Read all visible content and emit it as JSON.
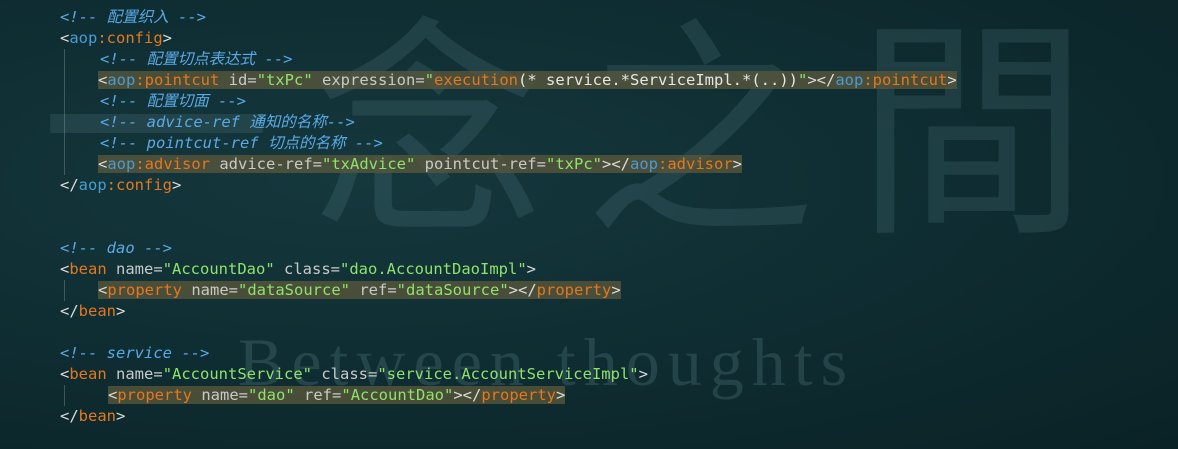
{
  "watermark": {
    "cjk": "一念之間",
    "en": "Between thoughts"
  },
  "lines": [
    {
      "indent": 60,
      "hl": false,
      "tokens": [
        [
          "c-comment",
          "<!-- 配置织入 -->"
        ]
      ]
    },
    {
      "indent": 60,
      "hl": false,
      "tokens": [
        [
          "c-bracket",
          "<"
        ],
        [
          "c-ns",
          "aop"
        ],
        [
          "c-tag",
          ":config"
        ],
        [
          "c-bracket",
          ">"
        ]
      ]
    },
    {
      "indent": 100,
      "hl": false,
      "tokens": [
        [
          "c-comment",
          "<!-- 配置切点表达式 -->"
        ]
      ]
    },
    {
      "indent": 98,
      "hl": true,
      "tokens": [
        [
          "c-bracket",
          "<"
        ],
        [
          "c-ns",
          "aop"
        ],
        [
          "c-tag",
          ":pointcut"
        ],
        [
          "c-attr",
          " id"
        ],
        [
          "c-eq",
          "="
        ],
        [
          "c-str",
          "\"txPc\""
        ],
        [
          "c-attr",
          " expression"
        ],
        [
          "c-eq",
          "="
        ],
        [
          "c-str",
          "\""
        ],
        [
          "c-call",
          "execution"
        ],
        [
          "c-plain",
          "(* service.*ServiceImpl.*(..))"
        ],
        [
          "c-str",
          "\""
        ],
        [
          "c-bracket",
          "></"
        ],
        [
          "c-ns",
          "aop"
        ],
        [
          "c-tag",
          ":pointcut"
        ],
        [
          "c-bracket",
          ">"
        ]
      ]
    },
    {
      "indent": 100,
      "hl": false,
      "tokens": [
        [
          "c-comment",
          "<!-- 配置切面 -->"
        ]
      ]
    },
    {
      "indent": 100,
      "hl": false,
      "tokens": [
        [
          "c-comment",
          "<!-- advice-ref 通知的名称-->"
        ]
      ]
    },
    {
      "indent": 100,
      "hl": false,
      "tokens": [
        [
          "c-comment",
          "<!-- pointcut-ref 切点的名称 -->"
        ]
      ]
    },
    {
      "indent": 98,
      "hl": true,
      "tokens": [
        [
          "c-bracket",
          "<"
        ],
        [
          "c-ns",
          "aop"
        ],
        [
          "c-tag",
          ":advisor"
        ],
        [
          "c-attr",
          " advice-ref"
        ],
        [
          "c-eq",
          "="
        ],
        [
          "c-str",
          "\"txAdvice\""
        ],
        [
          "c-attr",
          " pointcut-ref"
        ],
        [
          "c-eq",
          "="
        ],
        [
          "c-str",
          "\"txPc\""
        ],
        [
          "c-bracket",
          "></"
        ],
        [
          "c-ns",
          "aop"
        ],
        [
          "c-tag",
          ":advisor"
        ],
        [
          "c-bracket",
          ">"
        ]
      ]
    },
    {
      "indent": 60,
      "hl": false,
      "tokens": [
        [
          "c-bracket",
          "</"
        ],
        [
          "c-ns",
          "aop"
        ],
        [
          "c-tag",
          ":config"
        ],
        [
          "c-bracket",
          ">"
        ]
      ]
    },
    {
      "indent": 60,
      "hl": false,
      "tokens": []
    },
    {
      "indent": 60,
      "hl": false,
      "tokens": []
    },
    {
      "indent": 60,
      "hl": false,
      "tokens": [
        [
          "c-comment",
          "<!-- dao -->"
        ]
      ]
    },
    {
      "indent": 60,
      "hl": false,
      "tokens": [
        [
          "c-bracket",
          "<"
        ],
        [
          "c-tag",
          "bean"
        ],
        [
          "c-attr",
          " name"
        ],
        [
          "c-eq",
          "="
        ],
        [
          "c-str",
          "\"AccountDao\""
        ],
        [
          "c-attr",
          " class"
        ],
        [
          "c-eq",
          "="
        ],
        [
          "c-str",
          "\"dao.AccountDaoImpl\""
        ],
        [
          "c-bracket",
          ">"
        ]
      ]
    },
    {
      "indent": 98,
      "hl": true,
      "tokens": [
        [
          "c-bracket",
          "<"
        ],
        [
          "c-tag",
          "property"
        ],
        [
          "c-attr",
          " name"
        ],
        [
          "c-eq",
          "="
        ],
        [
          "c-str",
          "\"dataSource\""
        ],
        [
          "c-attr",
          " ref"
        ],
        [
          "c-eq",
          "="
        ],
        [
          "c-str",
          "\"dataSource\""
        ],
        [
          "c-bracket",
          "></"
        ],
        [
          "c-tag",
          "property"
        ],
        [
          "c-bracket",
          ">"
        ]
      ]
    },
    {
      "indent": 60,
      "hl": false,
      "tokens": [
        [
          "c-bracket",
          "</"
        ],
        [
          "c-tag",
          "bean"
        ],
        [
          "c-bracket",
          ">"
        ]
      ]
    },
    {
      "indent": 60,
      "hl": false,
      "tokens": []
    },
    {
      "indent": 60,
      "hl": false,
      "tokens": [
        [
          "c-comment",
          "<!-- service -->"
        ]
      ]
    },
    {
      "indent": 60,
      "hl": false,
      "tokens": [
        [
          "c-bracket",
          "<"
        ],
        [
          "c-tag",
          "bean"
        ],
        [
          "c-attr",
          " name"
        ],
        [
          "c-eq",
          "="
        ],
        [
          "c-str",
          "\"AccountService\""
        ],
        [
          "c-attr",
          " class"
        ],
        [
          "c-eq",
          "="
        ],
        [
          "c-str",
          "\"service.AccountServiceImpl\""
        ],
        [
          "c-bracket",
          ">"
        ]
      ]
    },
    {
      "indent": 108,
      "hl": true,
      "tokens": [
        [
          "c-bracket",
          "<"
        ],
        [
          "c-tag",
          "property"
        ],
        [
          "c-attr",
          " name"
        ],
        [
          "c-eq",
          "="
        ],
        [
          "c-str",
          "\"dao\""
        ],
        [
          "c-attr",
          " ref"
        ],
        [
          "c-eq",
          "="
        ],
        [
          "c-str",
          "\"AccountDao\""
        ],
        [
          "c-bracket",
          "></"
        ],
        [
          "c-tag",
          "property"
        ],
        [
          "c-bracket",
          ">"
        ]
      ]
    },
    {
      "indent": 60,
      "hl": false,
      "tokens": [
        [
          "c-bracket",
          "</"
        ],
        [
          "c-tag",
          "bean"
        ],
        [
          "c-bracket",
          ">"
        ]
      ]
    }
  ]
}
